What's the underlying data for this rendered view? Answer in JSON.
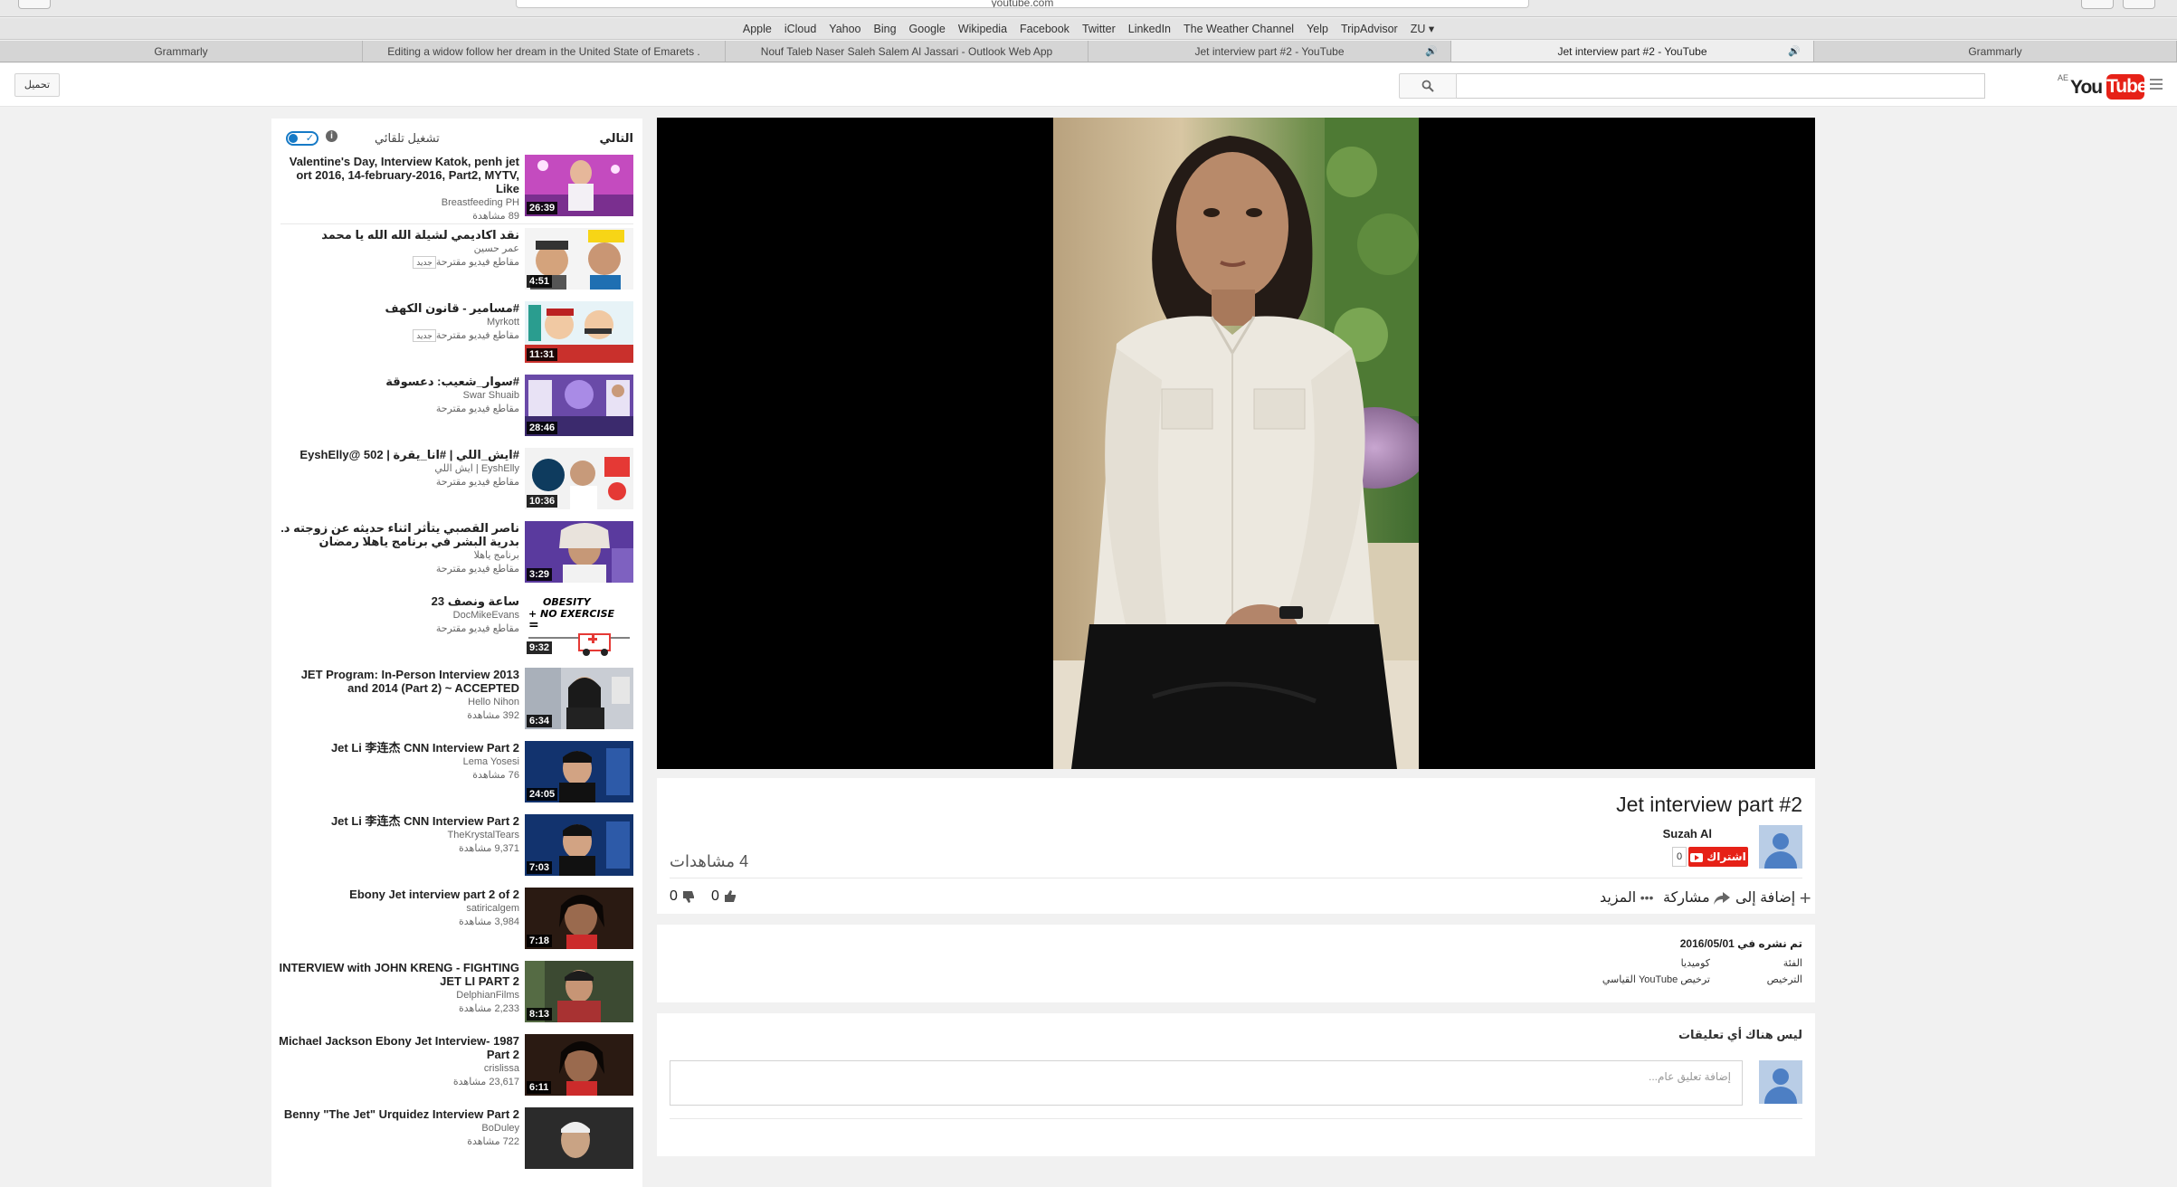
{
  "browser": {
    "url": "youtube.com",
    "bookmarks": [
      "Apple",
      "iCloud",
      "Yahoo",
      "Bing",
      "Google",
      "Wikipedia",
      "Facebook",
      "Twitter",
      "LinkedIn",
      "The Weather Channel",
      "Yelp",
      "TripAdvisor",
      "ZU ▾"
    ],
    "tabs": [
      {
        "label": "Grammarly",
        "audio": false,
        "active": false
      },
      {
        "label": "Editing a widow follow her dream in the United State of Emarets .",
        "audio": false,
        "active": false
      },
      {
        "label": "Nouf Taleb Naser Saleh Salem Al Jassari - Outlook Web App",
        "audio": false,
        "active": false
      },
      {
        "label": "Jet interview part #2 - YouTube",
        "audio": true,
        "active": false
      },
      {
        "label": "Jet interview part #2 - YouTube",
        "audio": true,
        "active": true
      },
      {
        "label": "Grammarly",
        "audio": false,
        "active": false
      }
    ]
  },
  "header": {
    "upload_label": "تحميل",
    "search_value": "",
    "logo": {
      "region": "AE",
      "you": "You",
      "tube": "Tube"
    }
  },
  "sidebar": {
    "up_next_label": "التالي",
    "autoplay_label": "تشغيل تلقائي",
    "autoplay_on": true,
    "items": [
      {
        "title": "Valentine's Day, Interview Katok, penh jet ort 2016, 14-february-2016, Part2, MYTV, Like",
        "channel": "Breastfeeding PH",
        "views": "89 مشاهدة",
        "duration": "26:39",
        "badge": "",
        "ltr": true,
        "thumb": "pink-stage"
      },
      {
        "title": "نقد اكاديمي لشيلة الله الله يا محمد",
        "channel": "عمر حسين",
        "views": "مقاطع فيديو مقترحة",
        "duration": "4:51",
        "badge": "جديد",
        "ltr": false,
        "thumb": "cartoon-faces"
      },
      {
        "title": "#مسامير - قانون الكهف",
        "channel": "Myrkott",
        "views": "مقاطع فيديو مقترحة",
        "duration": "11:31",
        "badge": "جديد",
        "ltr": false,
        "thumb": "cartoon-red"
      },
      {
        "title": "#سوار_شعيب: دعسوقة",
        "channel": "Swar Shuaib",
        "views": "مقاطع فيديو مقترحة",
        "duration": "28:46",
        "badge": "",
        "ltr": false,
        "thumb": "purple-show"
      },
      {
        "title": "#ايش_اللي | #انا_يقرة | 502 @EyshElly",
        "channel": "EyshElly | ايش اللي",
        "views": "مقاطع فيديو مقترحة",
        "duration": "10:36",
        "badge": "",
        "ltr": false,
        "thumb": "eysh"
      },
      {
        "title": "ناصر القصبي يتأثر اثناء حديثه عن زوجته د. بدرية البشر في برنامج ياهلا رمضان",
        "channel": "برنامج ياهلا",
        "views": "مقاطع فيديو مقترحة",
        "duration": "3:29",
        "badge": "",
        "ltr": false,
        "thumb": "purple-man"
      },
      {
        "title": "ساعة ونصف 23",
        "channel": "DocMikeEvans",
        "views": "مقاطع فيديو مقترحة",
        "duration": "9:32",
        "badge": "",
        "ltr": false,
        "thumb": "obesity",
        "thumb_text": [
          "OBESITY",
          "+ NO EXERCISE",
          "="
        ]
      },
      {
        "title": "JET Program: In-Person Interview 2013 and 2014 (Part 2) ~ ACCEPTED",
        "channel": "Hello Nihon",
        "views": "392 مشاهدة",
        "duration": "6:34",
        "badge": "",
        "ltr": true,
        "thumb": "jet-program"
      },
      {
        "title": "Jet Li 李连杰 CNN Interview Part 2",
        "channel": "Lema Yosesi",
        "views": "76 مشاهدة",
        "duration": "24:05",
        "badge": "",
        "ltr": true,
        "thumb": "cnn-blue"
      },
      {
        "title": "Jet Li 李连杰 CNN Interview Part 2",
        "channel": "TheKrystalTears",
        "views": "9,371 مشاهدة",
        "duration": "7:03",
        "badge": "",
        "ltr": true,
        "thumb": "cnn-blue"
      },
      {
        "title": "Ebony Jet interview part 2 of 2",
        "channel": "satiricalgem",
        "views": "3,984 مشاهدة",
        "duration": "7:18",
        "badge": "",
        "ltr": true,
        "thumb": "mj-dark"
      },
      {
        "title": "INTERVIEW with JOHN KRENG - FIGHTING JET LI PART 2",
        "channel": "DelphianFilms",
        "views": "2,233 مشاهدة",
        "duration": "8:13",
        "badge": "",
        "ltr": true,
        "thumb": "kreng"
      },
      {
        "title": "Michael Jackson Ebony Jet Interview- 1987 Part 2",
        "channel": "crislissa",
        "views": "23,617 مشاهدة",
        "duration": "6:11",
        "badge": "",
        "ltr": true,
        "thumb": "mj-dark"
      },
      {
        "title": "Benny \"The Jet\" Urquidez Interview Part 2",
        "channel": "BoDuley",
        "views": "722 مشاهدة",
        "duration": "",
        "badge": "",
        "ltr": true,
        "thumb": "benny"
      }
    ]
  },
  "watch": {
    "title": "Jet interview part #2",
    "channel": "Suzah Al",
    "subscribe_label": "اشتراك",
    "subscriber_count": "0",
    "view_count": "4 مشاهدات",
    "likes": "0",
    "dislikes": "0",
    "add_to_label": "إضافة إلى",
    "share_label": "مشاركة",
    "more_label": "المزيد"
  },
  "details": {
    "published": "تم نشره في 2016/05/01",
    "category_label": "الفئة",
    "category_value": "كوميديا",
    "license_label": "الترخيص",
    "license_value": "ترخيص YouTube القياسي"
  },
  "comments": {
    "empty_label": "ليس هناك أي تعليقات",
    "input_placeholder": "إضافة تعليق عام..."
  },
  "colors": {
    "accent_red": "#e62117",
    "link_blue": "#167ac6",
    "page_bg": "#f1f1f1"
  }
}
